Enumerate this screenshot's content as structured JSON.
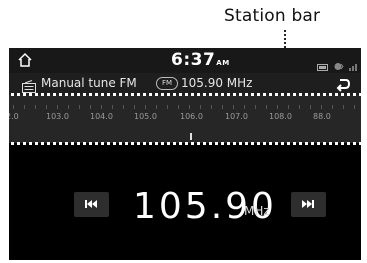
{
  "callout": {
    "label": "Station bar"
  },
  "status_bar": {
    "time": "6:37",
    "ampm": "AM"
  },
  "info_row": {
    "mode_label": "Manual tune FM",
    "band_badge": "FM",
    "frequency": "105.90 MHz"
  },
  "station_bar": {
    "tick_labels": [
      "2.0",
      "103.0",
      "104.0",
      "105.0",
      "106.0",
      "107.0",
      "108.0",
      "88.0"
    ]
  },
  "main": {
    "frequency": "105.90",
    "unit": "MHz"
  },
  "icons": {
    "home": "home-icon",
    "back": "back-icon",
    "radio": "radio-icon",
    "seek_prev": "skip-previous-icon",
    "seek_next": "skip-next-icon"
  }
}
